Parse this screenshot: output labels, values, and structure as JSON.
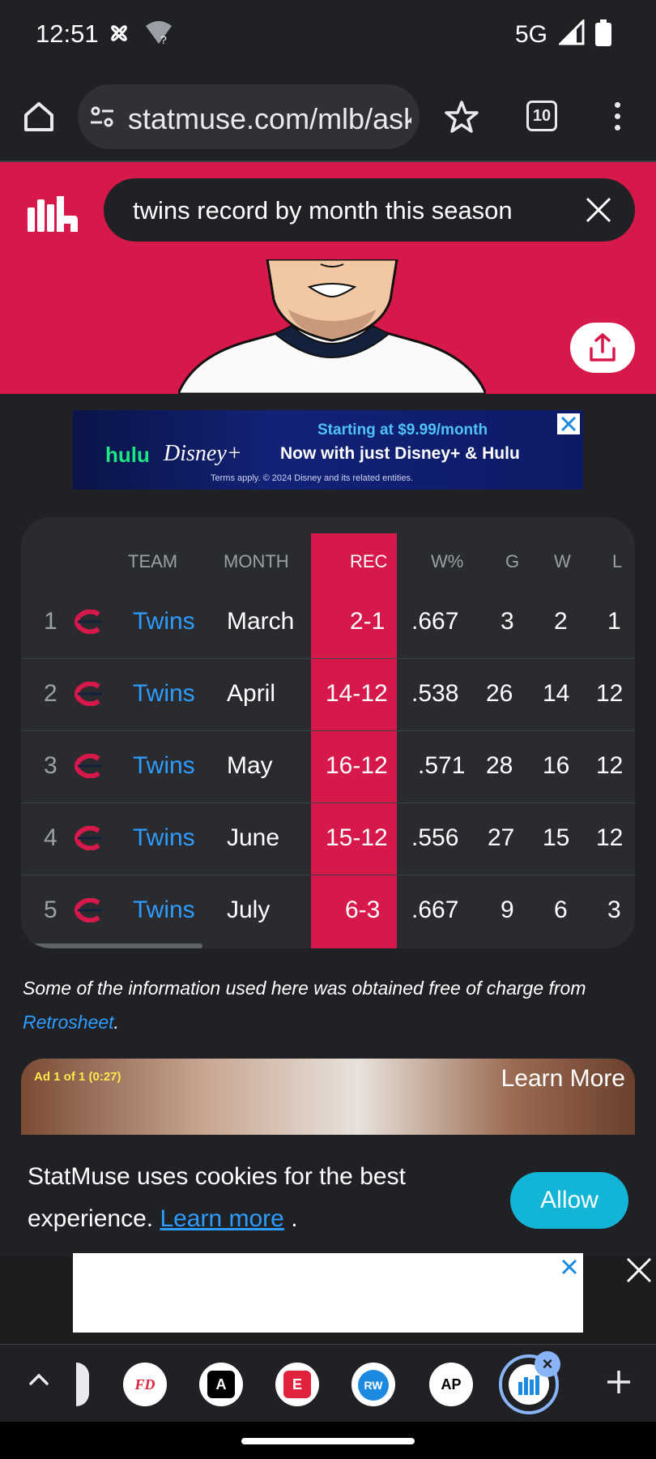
{
  "status_bar": {
    "time": "12:51",
    "network": "5G",
    "icons": [
      "fan-icon",
      "wifi-unknown-icon",
      "signal-icon",
      "battery-icon"
    ]
  },
  "browser": {
    "url": "statmuse.com/mlb/ask",
    "tab_count": "10"
  },
  "statmuse": {
    "query": "twins record by month this season",
    "accent_color": "#d6184a"
  },
  "ad_banner": {
    "brand1": "hulu",
    "brand2": "Disney+",
    "line1": "Starting at $9.99/month",
    "line2": "Now with just Disney+ & Hulu",
    "line3": "Terms apply. © 2024 Disney and its related entities."
  },
  "table": {
    "headers": {
      "team": "TEAM",
      "month": "MONTH",
      "rec": "REC",
      "wpct": "W%",
      "g": "G",
      "w": "W",
      "l": "L"
    },
    "rows": [
      {
        "rank": "1",
        "team": "Twins",
        "month": "March",
        "rec": "2-1",
        "wpct": ".667",
        "g": "3",
        "w": "2",
        "l": "1"
      },
      {
        "rank": "2",
        "team": "Twins",
        "month": "April",
        "rec": "14-12",
        "wpct": ".538",
        "g": "26",
        "w": "14",
        "l": "12"
      },
      {
        "rank": "3",
        "team": "Twins",
        "month": "May",
        "rec": "16-12",
        "wpct": ".571",
        "g": "28",
        "w": "16",
        "l": "12"
      },
      {
        "rank": "4",
        "team": "Twins",
        "month": "June",
        "rec": "15-12",
        "wpct": ".556",
        "g": "27",
        "w": "15",
        "l": "12"
      },
      {
        "rank": "5",
        "team": "Twins",
        "month": "July",
        "rec": "6-3",
        "wpct": ".667",
        "g": "9",
        "w": "6",
        "l": "3"
      }
    ]
  },
  "credit": {
    "text_before": "Some of the information used here was obtained free of charge from ",
    "link": "Retrosheet",
    "text_after": "."
  },
  "video_ad": {
    "label": "Ad 1 of 1 (0:27)",
    "learn_more": "Learn More"
  },
  "cookie": {
    "text": "StatMuse uses cookies for the best experience. ",
    "link": "Learn more",
    "suffix": " .",
    "allow": "Allow"
  },
  "taskbar": {
    "apps": [
      {
        "label": "FD",
        "color": "#e0223c"
      },
      {
        "label": "A",
        "color": "#000000"
      },
      {
        "label": "E",
        "color": "#e0223c"
      },
      {
        "label": "RW",
        "color": "#1c8ae0"
      },
      {
        "label": "AP",
        "color": "#000000"
      }
    ]
  }
}
